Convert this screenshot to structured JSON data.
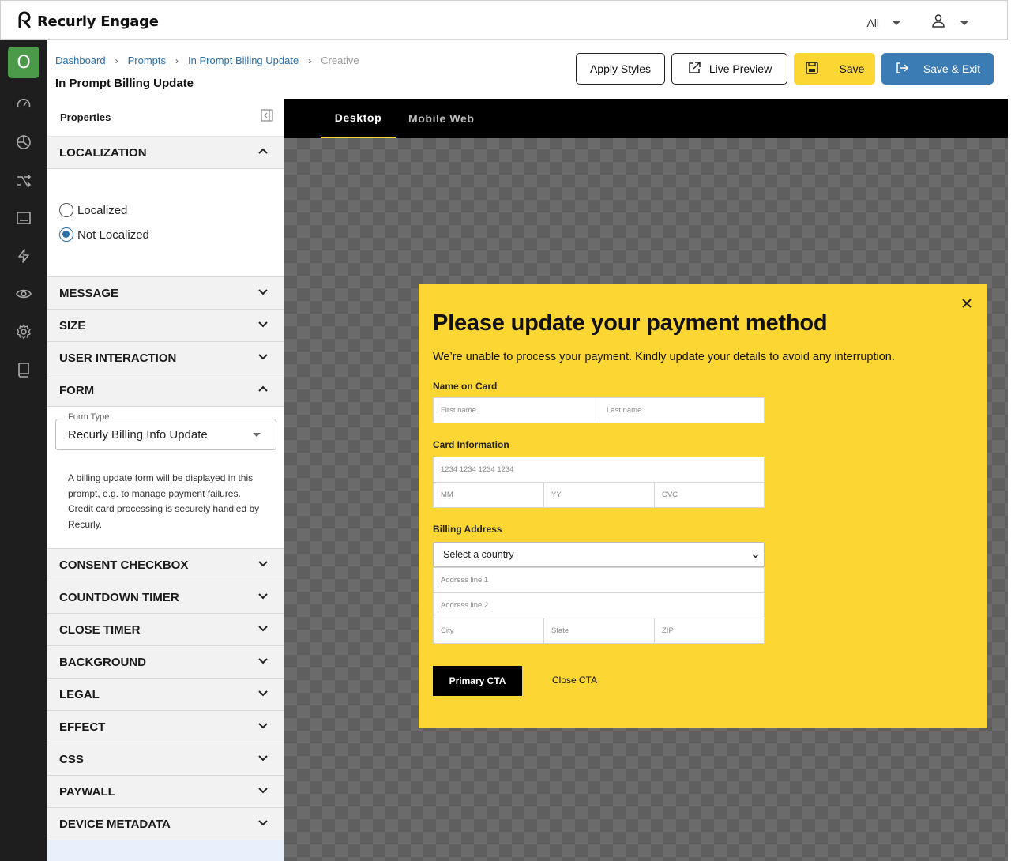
{
  "app": {
    "name": "Recurly Engage"
  },
  "topbar": {
    "filter_label": "All"
  },
  "rail": {
    "avatar_letter": "O"
  },
  "breadcrumb": {
    "items": [
      "Dashboard",
      "Prompts",
      "In Prompt Billing Update"
    ],
    "current": "Creative"
  },
  "page_title": "In Prompt Billing Update",
  "actions": {
    "apply_styles": "Apply Styles",
    "live_preview": "Live Preview",
    "save": "Save",
    "save_exit": "Save & Exit"
  },
  "panel": {
    "title": "Properties",
    "localization": {
      "label": "LOCALIZATION",
      "options": [
        "Localized",
        "Not Localized"
      ],
      "selected": "Not Localized"
    },
    "sections_before_form": [
      "MESSAGE",
      "SIZE",
      "USER INTERACTION"
    ],
    "form": {
      "label": "FORM",
      "type_label": "Form Type",
      "type_value": "Recurly Billing Info Update",
      "help": "A billing update form will be displayed in this prompt, e.g. to manage payment failures. Credit card processing is securely handled by Recurly."
    },
    "sections_after_form": [
      "CONSENT CHECKBOX",
      "COUNTDOWN TIMER",
      "CLOSE TIMER",
      "BACKGROUND",
      "LEGAL",
      "EFFECT",
      "CSS",
      "PAYWALL",
      "DEVICE METADATA"
    ]
  },
  "canvas": {
    "tabs": [
      "Desktop",
      "Mobile Web"
    ],
    "active_tab": "Desktop"
  },
  "prompt": {
    "title": "Please update your payment method",
    "description": "We’re unable to process your payment. Kindly update your details to avoid any interruption.",
    "name_label": "Name on Card",
    "first_name_placeholder": "First name",
    "last_name_placeholder": "Last name",
    "card_label": "Card Information",
    "card_number_placeholder": "1234 1234 1234 1234",
    "mm_placeholder": "MM",
    "yy_placeholder": "YY",
    "cvc_placeholder": "CVC",
    "billing_label": "Billing Address",
    "country_select": "Select a country",
    "address1_placeholder": "Address line 1",
    "address2_placeholder": "Address line 2",
    "city_placeholder": "City",
    "state_placeholder": "State",
    "zip_placeholder": "ZIP",
    "primary_cta": "Primary CTA",
    "close_cta": "Close CTA"
  },
  "colors": {
    "accent_yellow": "#fcd734",
    "primary_blue": "#3a7cb3",
    "rail_dark": "#1e1e1e",
    "avatar_green": "#4a9a4a"
  },
  "icons": [
    "recurly-logo-icon",
    "chevron-down-icon",
    "user-icon",
    "dashboard-gauge-icon",
    "pie-chart-icon",
    "shuffle-icon",
    "window-icon",
    "lightning-icon",
    "eye-icon",
    "gear-icon",
    "book-icon",
    "external-link-icon",
    "floppy-disk-icon",
    "exit-icon",
    "collapse-panel-icon",
    "chevron-up-icon",
    "close-icon"
  ]
}
